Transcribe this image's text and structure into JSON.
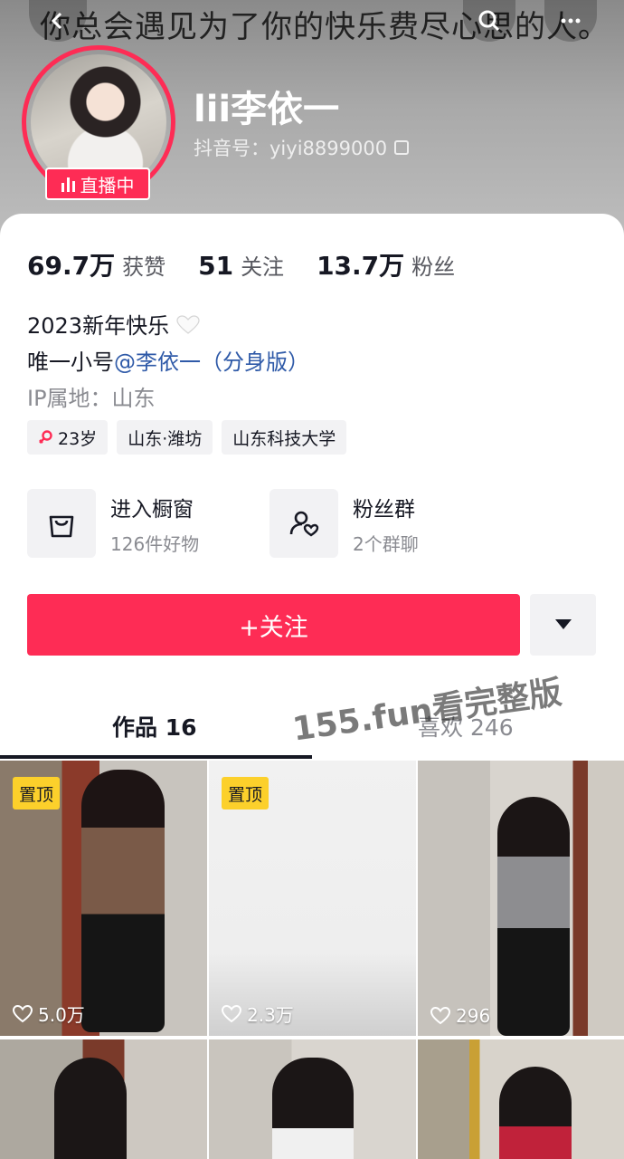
{
  "header": {
    "banner_text": "你总会遇见为了你的快乐费尽心思的人。",
    "username": "lii李依一",
    "douyin_id": "抖音号：yiyi8899000",
    "live_label": "直播中"
  },
  "stats": [
    {
      "num": "69.7万",
      "label": "获赞"
    },
    {
      "num": "51",
      "label": "关注"
    },
    {
      "num": "13.7万",
      "label": "粉丝"
    }
  ],
  "bio": {
    "line1": "2023新年快乐",
    "line2_prefix": "唯一小号",
    "line2_mention": "@李依一（分身版）",
    "ip": "IP属地：山东"
  },
  "tags": [
    "23岁",
    "山东·潍坊",
    "山东科技大学"
  ],
  "shortcuts": [
    {
      "title": "进入橱窗",
      "sub": "126件好物",
      "icon": "shopping-bag-icon"
    },
    {
      "title": "粉丝群",
      "sub": "2个群聊",
      "icon": "fan-group-icon"
    }
  ],
  "follow_label": "+关注",
  "tabs": {
    "works": "作品 16",
    "likes": "喜欢 246"
  },
  "watermark": "155.fun看完整版",
  "videos": [
    {
      "pinned": "置顶",
      "likes": "5.0万"
    },
    {
      "pinned": "置顶",
      "likes": "2.3万"
    },
    {
      "pinned": "",
      "likes": "296"
    },
    {
      "pinned": "",
      "likes": ""
    },
    {
      "pinned": "",
      "likes": ""
    },
    {
      "pinned": "",
      "likes": ""
    }
  ],
  "colors": {
    "accent": "#fe2c55",
    "pin": "#fcd02b",
    "mention": "#2f5aa8"
  }
}
